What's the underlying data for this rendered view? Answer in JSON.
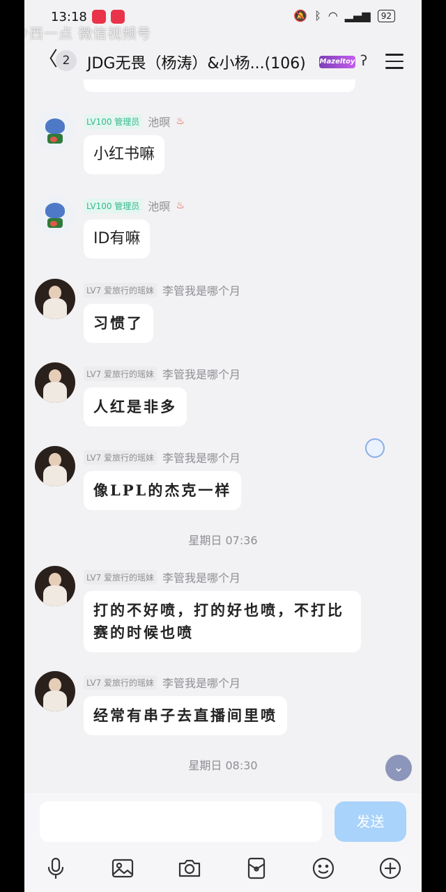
{
  "status_bar": {
    "time": "13:18",
    "battery": "92"
  },
  "watermark": "少西一点 微信视频号",
  "header": {
    "unread_count": "2",
    "title": "JDG无畏（杨涛）&小杨...(106)",
    "badge_text": "Mazeltoy"
  },
  "messages": [
    {
      "level": "LV100 管理员",
      "level_type": "admin",
      "nickname": "池暝",
      "avatar": "stitch",
      "text": "小红书嘛"
    },
    {
      "level": "LV100 管理员",
      "level_type": "admin",
      "nickname": "池暝",
      "avatar": "stitch",
      "text": "ID有嘛"
    },
    {
      "level": "LV7 爱旅行的瑶妹",
      "level_type": "member",
      "nickname": "李管我是哪个月",
      "avatar": "girl",
      "text": "习惯了"
    },
    {
      "level": "LV7 爱旅行的瑶妹",
      "level_type": "member",
      "nickname": "李管我是哪个月",
      "avatar": "girl",
      "text": "人红是非多"
    },
    {
      "level": "LV7 爱旅行的瑶妹",
      "level_type": "member",
      "nickname": "李管我是哪个月",
      "avatar": "girl",
      "text": "像LPL的杰克一样"
    },
    {
      "level": "LV7 爱旅行的瑶妹",
      "level_type": "member",
      "nickname": "李管我是哪个月",
      "avatar": "girl",
      "text": "打的不好喷，打的好也喷，不打比赛的时候也喷"
    },
    {
      "level": "LV7 爱旅行的瑶妹",
      "level_type": "member",
      "nickname": "李管我是哪个月",
      "avatar": "girl",
      "text": "经常有串子去直播间里喷"
    }
  ],
  "timestamps": [
    "星期日 07:36",
    "星期日 08:30"
  ],
  "composer": {
    "placeholder": "",
    "send_label": "发送"
  },
  "toolbar_icons": [
    "microphone-icon",
    "image-icon",
    "camera-icon",
    "red-packet-icon",
    "emoji-icon",
    "plus-icon"
  ]
}
